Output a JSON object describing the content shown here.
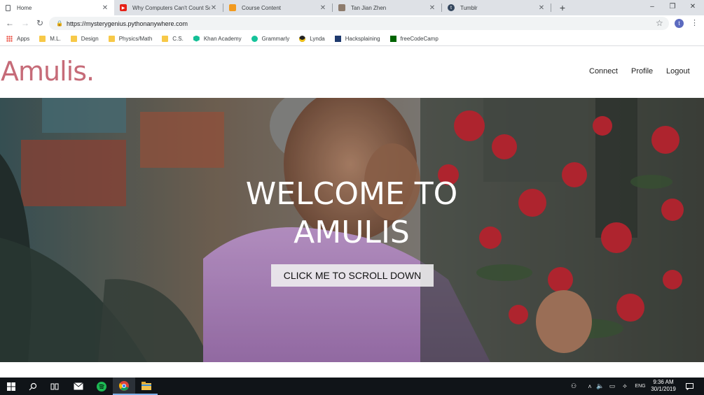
{
  "browser": {
    "tabs": [
      {
        "title": "Home",
        "icon": "page-icon"
      },
      {
        "title": "Why Computers Can't Count Sometimes",
        "icon": "youtube-icon"
      },
      {
        "title": "Course Content",
        "icon": "course-icon"
      },
      {
        "title": "Tan Jian Zhen",
        "icon": "profile-photo-icon"
      },
      {
        "title": "Tumblr",
        "icon": "tumblr-icon"
      }
    ],
    "new_tab": "+",
    "window_controls": {
      "minimize": "–",
      "maximize": "❐",
      "close": "✕"
    },
    "address": "https://mysterygenius.pythonanywhere.com",
    "avatar_letter": "t",
    "bookmarks": [
      {
        "label": "Apps",
        "icon": "apps-grid-icon"
      },
      {
        "label": "M.L.",
        "icon": "folder-icon"
      },
      {
        "label": "Design",
        "icon": "folder-icon"
      },
      {
        "label": "Physics/Math",
        "icon": "folder-icon"
      },
      {
        "label": "C.S.",
        "icon": "folder-icon"
      },
      {
        "label": "Khan Academy",
        "icon": "khan-academy-icon"
      },
      {
        "label": "Grammarly",
        "icon": "grammarly-icon"
      },
      {
        "label": "Lynda",
        "icon": "lynda-icon"
      },
      {
        "label": "Hacksplaining",
        "icon": "hacksplaining-icon"
      },
      {
        "label": "freeCodeCamp",
        "icon": "freecodecamp-icon"
      }
    ]
  },
  "site": {
    "brand": "Amulis.",
    "nav": [
      "Connect",
      "Profile",
      "Logout"
    ],
    "hero_title": "WELCOME TO AMULIS",
    "hero_button": "CLICK ME TO SCROLL DOWN"
  },
  "taskbar": {
    "time": "9:36 AM",
    "date": "30/1/2019",
    "lang": "ENG"
  },
  "colors": {
    "brand": "#c66b78",
    "tab_strip": "#dee1e6",
    "taskbar": "#101418"
  }
}
